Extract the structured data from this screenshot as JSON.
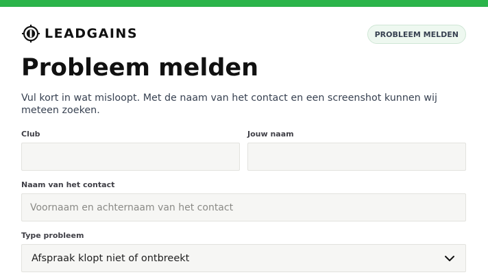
{
  "brand": {
    "name": "LEADGAINS",
    "icon": "leadgains-logo-icon"
  },
  "header": {
    "report_button": "PROBLEEM MELDEN"
  },
  "page": {
    "title": "Probleem melden",
    "subtitle": "Vul kort in wat misloopt. Met de naam van het contact en een screenshot kunnen wij meteen zoeken."
  },
  "form": {
    "club": {
      "label": "Club",
      "value": "",
      "placeholder": ""
    },
    "your_name": {
      "label": "Jouw naam",
      "value": "",
      "placeholder": ""
    },
    "contact_name": {
      "label": "Naam van het contact",
      "value": "",
      "placeholder": "Voornaam en achternaam van het contact"
    },
    "problem_type": {
      "label": "Type probleem",
      "selected": "Afspraak klopt niet of ontbreekt",
      "icon": "chevron-down-icon"
    }
  },
  "colors": {
    "accent": "#2bb44a",
    "pill_bg": "#eef8f0",
    "field_bg": "#f6f6f4"
  }
}
